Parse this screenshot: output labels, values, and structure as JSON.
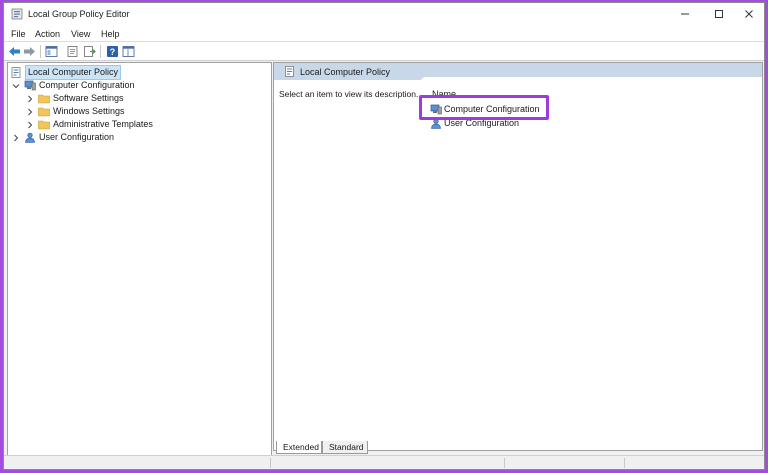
{
  "window": {
    "title": "Local Group Policy Editor",
    "icons": {
      "app": "policy-editor-icon",
      "minimize": "minimize-icon",
      "maximize": "maximize-icon",
      "close": "close-icon"
    }
  },
  "menu": {
    "items": [
      "File",
      "Action",
      "View",
      "Help"
    ]
  },
  "toolbar": {
    "buttons": [
      "back-arrow-icon",
      "forward-arrow-icon",
      "show-hide-tree-icon",
      "properties-icon",
      "export-list-icon",
      "help-icon",
      "details-view-icon"
    ]
  },
  "tree": {
    "root": "Local Computer Policy",
    "computer_configuration": "Computer Configuration",
    "children": [
      "Software Settings",
      "Windows Settings",
      "Administrative Templates"
    ],
    "user_configuration": "User Configuration"
  },
  "details": {
    "header": "Local Computer Policy",
    "description": "Select an item to view its description.",
    "column_name": "Name",
    "items": [
      "Computer Configuration",
      "User Configuration"
    ]
  },
  "tabs": [
    "Extended",
    "Standard"
  ],
  "colors": {
    "accent_highlight": "#9b3be0",
    "selection": "#cce4f7",
    "folder": "#f2c55c",
    "header_band": "#c8d8e8"
  }
}
